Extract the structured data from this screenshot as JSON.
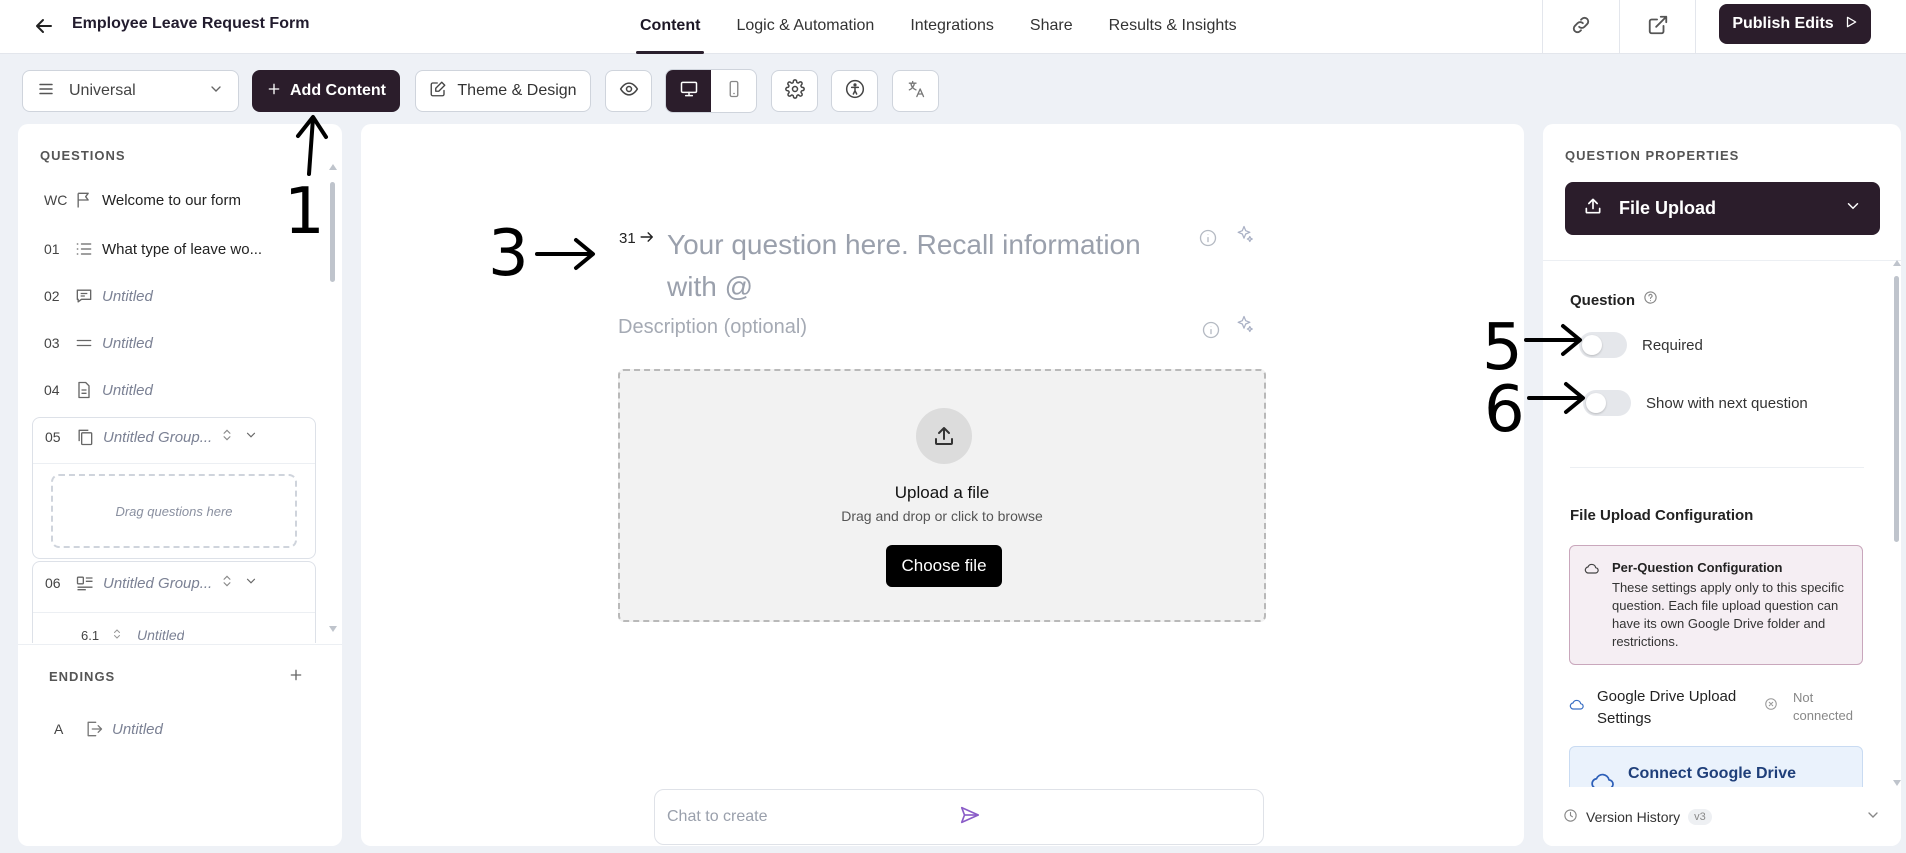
{
  "header": {
    "title": "Employee Leave Request Form",
    "tabs": [
      "Content",
      "Logic & Automation",
      "Integrations",
      "Share",
      "Results & Insights"
    ],
    "active_tab": "Content",
    "publish_label": "Publish Edits"
  },
  "toolbar": {
    "view_select": "Universal",
    "add_content": "Add Content",
    "theme_design": "Theme & Design"
  },
  "sidebar": {
    "questions_title": "QUESTIONS",
    "items": [
      {
        "num": "WC",
        "icon": "flag-icon",
        "label": "Welcome to our form"
      },
      {
        "num": "01",
        "icon": "list-icon",
        "label": "What type of leave wo..."
      },
      {
        "num": "02",
        "icon": "chat-icon",
        "label": "Untitled"
      },
      {
        "num": "03",
        "icon": "equals-icon",
        "label": "Untitled"
      },
      {
        "num": "04",
        "icon": "document-icon",
        "label": "Untitled"
      }
    ],
    "groups": [
      {
        "num": "05",
        "label": "Untitled Group...",
        "drop_text": "Drag questions here"
      },
      {
        "num": "06",
        "label": "Untitled Group...",
        "sub_num": "6.1",
        "sub_label": "Untitled"
      }
    ],
    "endings_title": "ENDINGS",
    "endings": [
      {
        "letter": "A",
        "label": "Untitled"
      }
    ]
  },
  "canvas": {
    "question_number": "31",
    "question_placeholder": "Your question here. Recall information with @",
    "description_placeholder": "Description (optional)",
    "upload_title": "Upload a file",
    "upload_subtitle": "Drag and drop or click to browse",
    "choose_file": "Choose file",
    "chat_placeholder": "Chat to create"
  },
  "properties": {
    "title": "QUESTION PROPERTIES",
    "type_label": "File Upload",
    "question_section": "Question",
    "required_label": "Required",
    "required_on": false,
    "show_next_label": "Show with next question",
    "show_next_on": false,
    "config_title": "File Upload Configuration",
    "note_title": "Per-Question Configuration",
    "note_body": "These settings apply only to this specific question. Each file upload question can have its own Google Drive folder and restrictions.",
    "drive_title": "Google Drive Upload Settings",
    "drive_status": "Not connected",
    "connect_label": "Connect Google Drive",
    "version_label": "Version History",
    "version_badge": "v3"
  },
  "annotations": [
    "1",
    "3",
    "5",
    "6"
  ],
  "colors": {
    "accent": "#2b1d2b",
    "note_bg": "#f5eef3",
    "connect_bg": "#eaf2fc",
    "send": "#8a5cc7"
  }
}
